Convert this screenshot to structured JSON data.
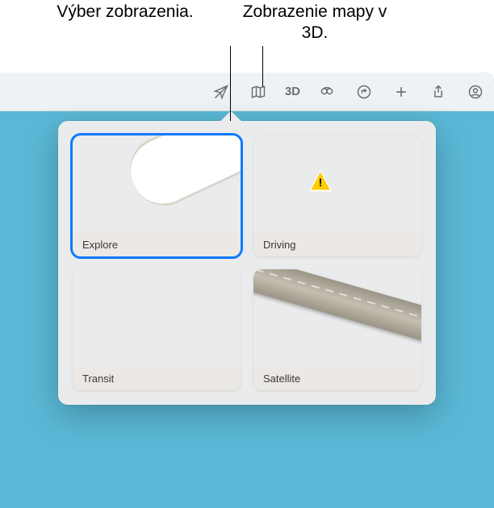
{
  "callouts": {
    "chooseView": "Výber zobrazenia.",
    "map3d": "Zobrazenie mapy v 3D."
  },
  "toolbar": {
    "threeDLabel": "3D"
  },
  "views": {
    "explore": "Explore",
    "driving": "Driving",
    "transit": "Transit",
    "satellite": "Satellite"
  }
}
